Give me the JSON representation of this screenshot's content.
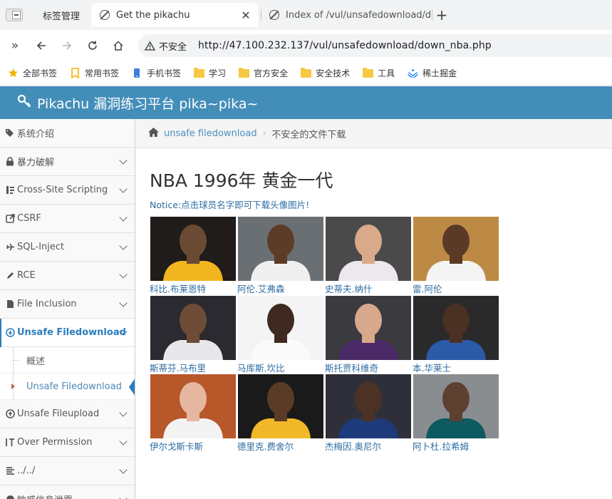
{
  "browser": {
    "tabs": [
      {
        "title": "标签管理"
      },
      {
        "title": "Get the pikachu"
      },
      {
        "title": "Index of /vul/unsafedownload/do"
      }
    ],
    "insecure_label": "不安全",
    "url": "http://47.100.232.137/vul/unsafedownload/down_nba.php",
    "bookmarks": [
      {
        "label": "全部书签",
        "icon": "star-icon"
      },
      {
        "label": "常用书签",
        "icon": "bookmark-icon"
      },
      {
        "label": "手机书签",
        "icon": "phone-icon"
      },
      {
        "label": "学习",
        "icon": "folder-icon"
      },
      {
        "label": "官方安全",
        "icon": "folder-icon"
      },
      {
        "label": "安全技术",
        "icon": "folder-icon"
      },
      {
        "label": "工具",
        "icon": "folder-icon"
      },
      {
        "label": "稀土掘金",
        "icon": "juejin-icon"
      }
    ]
  },
  "site": {
    "title": "Pikachu 漏洞练习平台 pika~pika~"
  },
  "sidebar": {
    "items": [
      {
        "label": "系统介绍"
      },
      {
        "label": "暴力破解"
      },
      {
        "label": "Cross-Site Scripting"
      },
      {
        "label": "CSRF"
      },
      {
        "label": "SQL-Inject"
      },
      {
        "label": "RCE"
      },
      {
        "label": "File Inclusion"
      },
      {
        "label": "Unsafe Filedownload"
      },
      {
        "label": "Unsafe Fileupload"
      },
      {
        "label": "Over Permission"
      },
      {
        "label": "../../"
      },
      {
        "label": "敏感信息泄露"
      }
    ],
    "submenu": [
      {
        "label": "概述"
      },
      {
        "label": "Unsafe Filedownload"
      }
    ]
  },
  "breadcrumbs": {
    "link": "unsafe filedownload",
    "current": "不安全的文件下载"
  },
  "main": {
    "title": "NBA 1996年 黄金一代",
    "notice": "Notice:点击球员名字即可下载头像图片!",
    "players": [
      {
        "name": "科比.布莱恩特",
        "bg": "#1f1c1a",
        "skin": "#6b4a33",
        "jersey": "#f0b51f"
      },
      {
        "name": "阿伦.艾弗森",
        "bg": "#6a6f74",
        "skin": "#5c3b27",
        "jersey": "#efefef"
      },
      {
        "name": "史蒂夫.纳什",
        "bg": "#4a4a4a",
        "skin": "#d9a98a",
        "jersey": "#ece8ee"
      },
      {
        "name": "雷.阿伦",
        "bg": "#bd8a45",
        "skin": "#5a3a26",
        "jersey": "#f4f4f4"
      },
      {
        "name": "斯蒂芬.马布里",
        "bg": "#2a2a30",
        "skin": "#6d4b36",
        "jersey": "#e7e7ea"
      },
      {
        "name": "马库斯.坎比",
        "bg": "#f4f4f4",
        "skin": "#3e2a20",
        "jersey": "#fafafa"
      },
      {
        "name": "斯托贾科维奇",
        "bg": "#3b3b3f",
        "skin": "#d7a88c",
        "jersey": "#4a2a66"
      },
      {
        "name": "本.华莱士",
        "bg": "#2a2a2a",
        "skin": "#4a3124",
        "jersey": "#2b5aa8"
      },
      {
        "name": "伊尔戈斯卡斯",
        "bg": "#b8572a",
        "skin": "#e5b7a0",
        "jersey": "#f3f3f3"
      },
      {
        "name": "德里克.费舍尔",
        "bg": "#1a1a1a",
        "skin": "#5a3b26",
        "jersey": "#f1b82a"
      },
      {
        "name": "杰梅因.奥尼尔",
        "bg": "#2f2f3a",
        "skin": "#4c3224",
        "jersey": "#1d3b7a"
      },
      {
        "name": "阿卜杜.拉希姆",
        "bg": "#8a8d8f",
        "skin": "#5e4030",
        "jersey": "#0d5a60"
      }
    ]
  }
}
